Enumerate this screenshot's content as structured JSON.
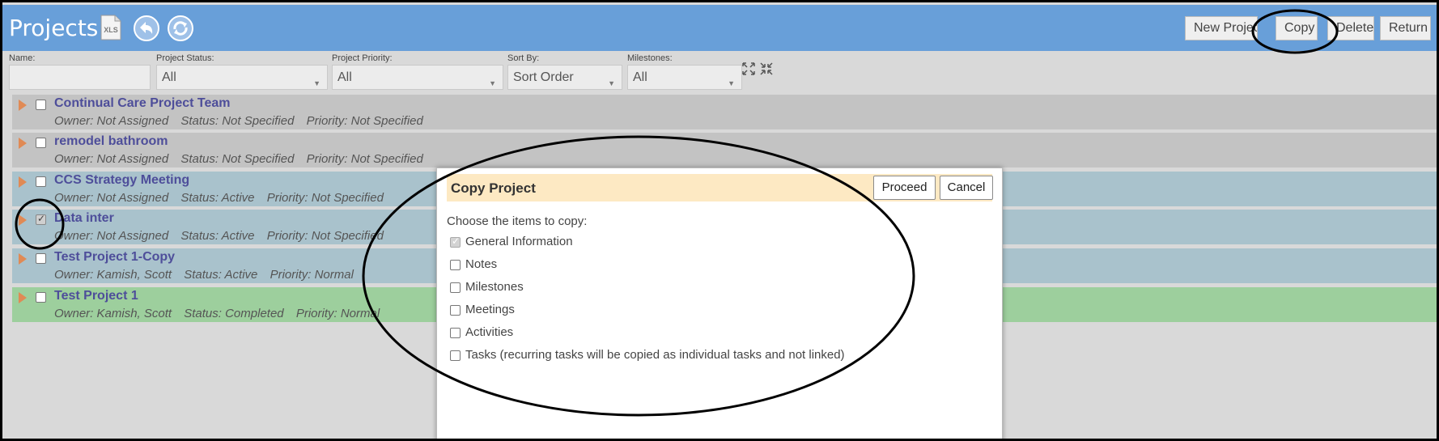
{
  "header": {
    "title": "Projects",
    "xls_label": "XLS",
    "buttons": {
      "new_project": "New Project",
      "copy": "Copy",
      "delete": "Delete",
      "return": "Return"
    },
    "color": "#689fd9"
  },
  "filters": {
    "name": {
      "label": "Name:",
      "value": ""
    },
    "status": {
      "label": "Project Status:",
      "value": "All"
    },
    "priority": {
      "label": "Project Priority:",
      "value": "All"
    },
    "sort": {
      "label": "Sort By:",
      "value": "Sort Order"
    },
    "milestones": {
      "label": "Milestones:",
      "value": "All"
    }
  },
  "projects": [
    {
      "name": "Continual Care Project Team",
      "owner": "Owner: Not Assigned",
      "status": "Status: Not Specified",
      "priority": "Priority: Not Specified",
      "checked": false,
      "color": "#c3c3c3"
    },
    {
      "name": "remodel bathroom",
      "owner": "Owner: Not Assigned",
      "status": "Status: Not Specified",
      "priority": "Priority: Not Specified",
      "checked": false,
      "color": "#c3c3c3"
    },
    {
      "name": "CCS Strategy Meeting",
      "owner": "Owner: Not Assigned",
      "status": "Status: Active",
      "priority": "Priority: Not Specified",
      "checked": false,
      "color": "#a9c2cc"
    },
    {
      "name": "Data inter",
      "owner": "Owner: Not Assigned",
      "status": "Status: Active",
      "priority": "Priority: Not Specified",
      "checked": true,
      "color": "#a9c2cc"
    },
    {
      "name": "Test Project 1-Copy",
      "owner": "Owner: Kamish, Scott",
      "status": "Status: Active",
      "priority": "Priority: Normal",
      "checked": false,
      "color": "#a9c2cc"
    },
    {
      "name": "Test Project 1",
      "owner": "Owner: Kamish, Scott",
      "status": "Status: Completed",
      "priority": "Priority: Normal",
      "checked": false,
      "color": "#9dcf9d"
    }
  ],
  "dialog": {
    "title": "Copy Project",
    "proceed_label": "Proceed",
    "cancel_label": "Cancel",
    "instructions": "Choose the items to copy:",
    "options": [
      {
        "label": "General Information",
        "checked": true
      },
      {
        "label": "Notes",
        "checked": false
      },
      {
        "label": "Milestones",
        "checked": false
      },
      {
        "label": "Meetings",
        "checked": false
      },
      {
        "label": "Activities",
        "checked": false
      },
      {
        "label": "Tasks (recurring tasks will be copied as individual tasks and not linked)",
        "checked": false
      }
    ]
  }
}
